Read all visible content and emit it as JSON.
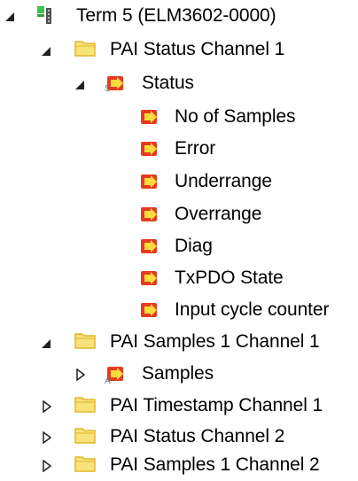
{
  "tree": {
    "terminal": {
      "label": "Term 5 (ELM3602-0000)",
      "icon": "terminal-module-icon"
    },
    "pai_status_channel_1": {
      "label": "PAI Status Channel 1",
      "icon": "folder-icon",
      "status": {
        "label": "Status",
        "icon": "input-variable-icon",
        "badge": "S",
        "children": [
          {
            "label": "No of Samples",
            "icon": "input-variable-icon"
          },
          {
            "label": "Error",
            "icon": "input-variable-icon"
          },
          {
            "label": "Underrange",
            "icon": "input-variable-icon"
          },
          {
            "label": "Overrange",
            "icon": "input-variable-icon"
          },
          {
            "label": "Diag",
            "icon": "input-variable-icon"
          },
          {
            "label": "TxPDO State",
            "icon": "input-variable-icon"
          },
          {
            "label": "Input cycle counter",
            "icon": "input-variable-icon"
          }
        ]
      }
    },
    "pai_samples_1_channel_1": {
      "label": "PAI Samples 1 Channel 1",
      "icon": "folder-icon",
      "samples": {
        "label": "Samples",
        "icon": "input-variable-icon",
        "badge": "A"
      }
    },
    "collapsed": [
      {
        "label": "PAI Timestamp Channel 1",
        "icon": "folder-icon"
      },
      {
        "label": "PAI Status Channel 2",
        "icon": "folder-icon"
      },
      {
        "label": "PAI Samples 1 Channel 2",
        "icon": "folder-icon"
      }
    ]
  },
  "colors": {
    "folder_fill": "#f8e27a",
    "folder_stroke": "#e2b72b",
    "variable_arrow_fill": "#f9dc3b",
    "variable_arrow_bg": "#e53b1e",
    "terminal_green": "#35c64a"
  }
}
